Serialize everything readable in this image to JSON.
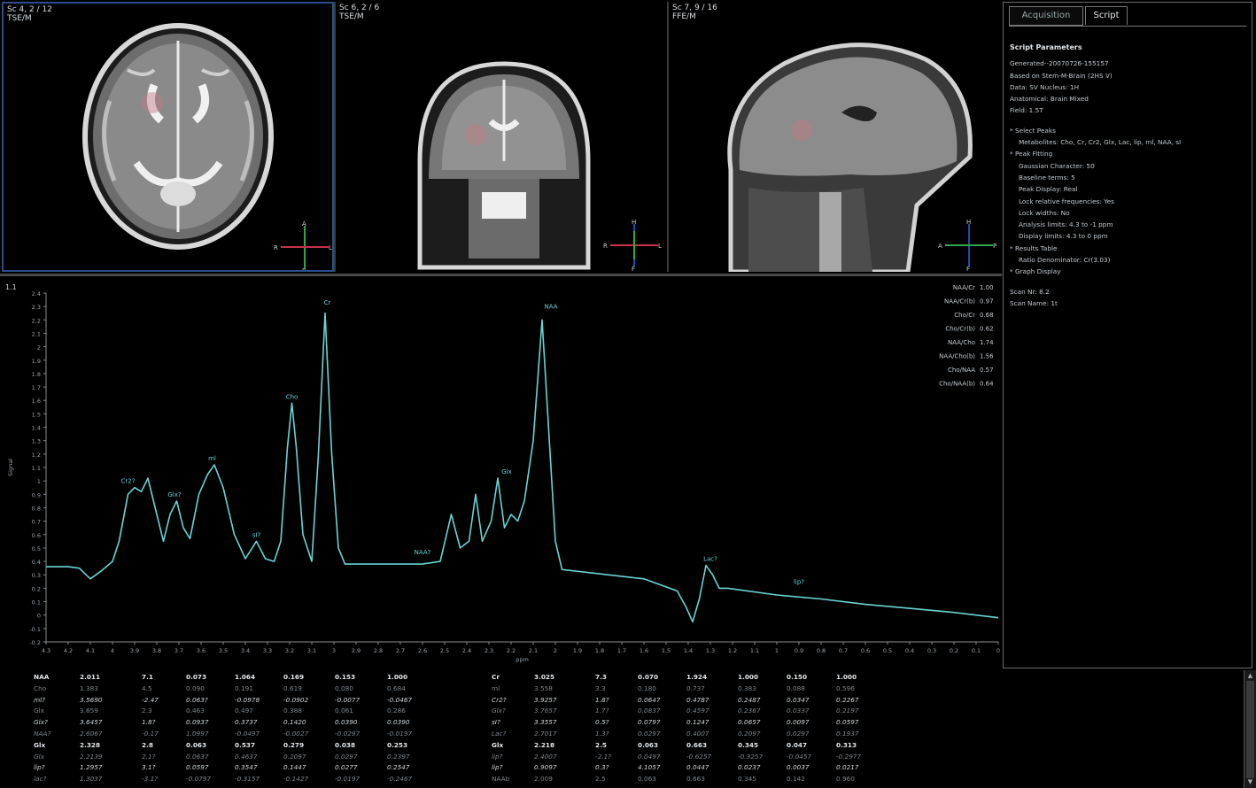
{
  "viewports": [
    {
      "label_line1": "Sc 4, 2 / 12",
      "label_line2": "TSE/M",
      "orientation": [
        "A",
        "R",
        "L",
        "P"
      ]
    },
    {
      "label_line1": "Sc 6, 2 / 6",
      "label_line2": "TSE/M",
      "orientation": [
        "H",
        "R",
        "L",
        "F"
      ]
    },
    {
      "label_line1": "Sc 7, 9 / 16",
      "label_line2": "FFE/M",
      "orientation": [
        "H",
        "A",
        "P",
        "F"
      ]
    }
  ],
  "tabs": {
    "acquisition": "Acquisition",
    "script": "Script"
  },
  "script_panel": {
    "title": "Script Parameters",
    "header_lines": [
      "Generated--20070726-155157",
      "Based on Stem-M-Brain (2HS V)",
      "Data: SV  Nucleus: 1H",
      "Anatomical: Brain  Mixed",
      "Field: 1.5T"
    ],
    "select_peaks_title": "* Select Peaks",
    "select_peaks": [
      "Metabolites: Cho, Cr, Cr2, Glx, Lac, lip, ml, NAA, sI"
    ],
    "peak_fitting_title": "* Peak Fitting",
    "peak_fitting": [
      "Gaussian Character: 50",
      "Baseline terms: 5",
      "Peak Display: Real",
      "Lock relative frequencies: Yes",
      "Lock widths: No",
      "Analysis limits: 4.3 to -1 ppm",
      "Display limits: 4.3 to 0 ppm"
    ],
    "results_table_title": "* Results Table",
    "results_table": [
      "Ratio Denominator: Cr(3.03)"
    ],
    "graph_display_title": "* Graph Display",
    "footer_lines": [
      "Scan Nr: 8.2",
      "Scan Name: 1t"
    ]
  },
  "chart_data": {
    "type": "line",
    "title": "",
    "corner_label": "1.1",
    "ylabel": "Signal",
    "xlabel": "ppm",
    "xlim": [
      4.3,
      0
    ],
    "ylim": [
      -0.2,
      2.4
    ],
    "x_ticks": [
      "4.3",
      "4.2",
      "4.1",
      "4",
      "3.9",
      "3.8",
      "3.7",
      "3.6",
      "3.5",
      "3.4",
      "3.3",
      "3.2",
      "3.1",
      "3",
      "2.9",
      "2.8",
      "2.7",
      "2.6",
      "2.5",
      "2.4",
      "2.3",
      "2.2",
      "2.1",
      "2",
      "1.9",
      "1.8",
      "1.7",
      "1.6",
      "1.5",
      "1.4",
      "1.3",
      "1.2",
      "1.1",
      "1",
      "0.9",
      "0.8",
      "0.7",
      "0.6",
      "0.5",
      "0.4",
      "0.3",
      "0.2",
      "0.1",
      "0"
    ],
    "y_ticks": [
      "-0.2",
      "-0.1",
      "0",
      "0.1",
      "0.2",
      "0.3",
      "0.4",
      "0.5",
      "0.6",
      "0.7",
      "0.8",
      "0.9",
      "1",
      "1.1",
      "1.2",
      "1.3",
      "1.4",
      "1.5",
      "1.6",
      "1.7",
      "1.8",
      "1.9",
      "2",
      "2.1",
      "2.2",
      "2.3",
      "2.4"
    ],
    "series": [
      {
        "color": "#6ad4d4",
        "points": [
          [
            4.3,
            0.36
          ],
          [
            4.2,
            0.36
          ],
          [
            4.15,
            0.35
          ],
          [
            4.1,
            0.27
          ],
          [
            4.05,
            0.33
          ],
          [
            4.0,
            0.4
          ],
          [
            3.97,
            0.55
          ],
          [
            3.93,
            0.9
          ],
          [
            3.9,
            0.95
          ],
          [
            3.87,
            0.92
          ],
          [
            3.84,
            1.02
          ],
          [
            3.8,
            0.75
          ],
          [
            3.77,
            0.55
          ],
          [
            3.74,
            0.75
          ],
          [
            3.71,
            0.85
          ],
          [
            3.68,
            0.65
          ],
          [
            3.65,
            0.57
          ],
          [
            3.61,
            0.9
          ],
          [
            3.57,
            1.05
          ],
          [
            3.54,
            1.12
          ],
          [
            3.5,
            0.95
          ],
          [
            3.45,
            0.6
          ],
          [
            3.4,
            0.42
          ],
          [
            3.35,
            0.55
          ],
          [
            3.31,
            0.42
          ],
          [
            3.27,
            0.4
          ],
          [
            3.24,
            0.55
          ],
          [
            3.21,
            1.25
          ],
          [
            3.19,
            1.58
          ],
          [
            3.17,
            1.25
          ],
          [
            3.14,
            0.6
          ],
          [
            3.1,
            0.4
          ],
          [
            3.07,
            1.2
          ],
          [
            3.04,
            2.25
          ],
          [
            3.01,
            1.2
          ],
          [
            2.98,
            0.5
          ],
          [
            2.95,
            0.38
          ],
          [
            2.8,
            0.38
          ],
          [
            2.6,
            0.38
          ],
          [
            2.52,
            0.4
          ],
          [
            2.47,
            0.75
          ],
          [
            2.43,
            0.5
          ],
          [
            2.39,
            0.55
          ],
          [
            2.36,
            0.9
          ],
          [
            2.33,
            0.55
          ],
          [
            2.29,
            0.7
          ],
          [
            2.26,
            1.02
          ],
          [
            2.23,
            0.65
          ],
          [
            2.2,
            0.75
          ],
          [
            2.17,
            0.7
          ],
          [
            2.14,
            0.85
          ],
          [
            2.1,
            1.3
          ],
          [
            2.06,
            2.2
          ],
          [
            2.02,
            1.1
          ],
          [
            2.0,
            0.55
          ],
          [
            1.97,
            0.34
          ],
          [
            1.6,
            0.27
          ],
          [
            1.45,
            0.18
          ],
          [
            1.41,
            0.06
          ],
          [
            1.38,
            -0.05
          ],
          [
            1.35,
            0.12
          ],
          [
            1.32,
            0.37
          ],
          [
            1.29,
            0.3
          ],
          [
            1.26,
            0.2
          ],
          [
            1.22,
            0.2
          ],
          [
            1.0,
            0.15
          ],
          [
            0.8,
            0.12
          ],
          [
            0.6,
            0.08
          ],
          [
            0.4,
            0.05
          ],
          [
            0.2,
            0.02
          ],
          [
            0.0,
            -0.02
          ]
        ]
      }
    ],
    "peak_labels": [
      {
        "x": 3.93,
        "y": 0.95,
        "text": "Cr2?"
      },
      {
        "x": 3.72,
        "y": 0.85,
        "text": "Glx?"
      },
      {
        "x": 3.55,
        "y": 1.12,
        "text": "ml"
      },
      {
        "x": 3.35,
        "y": 0.55,
        "text": "sI?"
      },
      {
        "x": 3.19,
        "y": 1.58,
        "text": "Cho"
      },
      {
        "x": 3.03,
        "y": 2.28,
        "text": "Cr"
      },
      {
        "x": 2.6,
        "y": 0.42,
        "text": "NAA?"
      },
      {
        "x": 2.22,
        "y": 1.02,
        "text": "Glx"
      },
      {
        "x": 2.02,
        "y": 2.25,
        "text": "NAA"
      },
      {
        "x": 1.3,
        "y": 0.37,
        "text": "Lac?"
      },
      {
        "x": 0.9,
        "y": 0.2,
        "text": "lip?"
      }
    ],
    "ratios": [
      {
        "label": "NAA/Cr",
        "value": "1.00"
      },
      {
        "label": "NAA/Cr(b)",
        "value": "0.97"
      },
      {
        "label": "Cho/Cr",
        "value": "0.68"
      },
      {
        "label": "Cho/Cr(b)",
        "value": "0.62"
      },
      {
        "label": "NAA/Cho",
        "value": "1.74"
      },
      {
        "label": "NAA/Cho(b)",
        "value": "1.56"
      },
      {
        "label": "Cho/NAA",
        "value": "0.57"
      },
      {
        "label": "Cho/NAA(b)",
        "value": "0.64"
      }
    ]
  },
  "results_table": {
    "left": [
      {
        "name": "NAA",
        "cells": [
          "2.011",
          "7.1",
          "0.073",
          "1.064",
          "0.169",
          "0.153",
          "1.000"
        ],
        "style": "bold"
      },
      {
        "name": "Cho",
        "cells": [
          "1.383",
          "4.5",
          "0.090",
          "0.191",
          "0.619",
          "0.080",
          "0.684"
        ],
        "style": "dim"
      },
      {
        "name": "ml?",
        "cells": [
          "3.5690",
          "-2.47",
          "0.063?",
          "-0.0978",
          "-0.0902",
          "-0.0077",
          "-0.0467"
        ],
        "style": "italic"
      },
      {
        "name": "Glx",
        "cells": [
          "3.659",
          "2.3",
          "0.463",
          "0.497",
          "0.388",
          "0.061",
          "0.286"
        ],
        "style": "dim"
      },
      {
        "name": "Glx?",
        "cells": [
          "3.6457",
          "1.8?",
          "0.0937",
          "0.3737",
          "0.1420",
          "0.0390",
          "0.0390"
        ],
        "style": "italic"
      },
      {
        "name": "NAA?",
        "cells": [
          "2.6067",
          "-0.17",
          "1.0997",
          "-0.0497",
          "-0.0027",
          "-0.0297",
          "-0.0197"
        ],
        "style": "dimitalic"
      },
      {
        "name": "Glx",
        "cells": [
          "2.328",
          "2.8",
          "0.063",
          "0.537",
          "0.279",
          "0.038",
          "0.253"
        ],
        "style": "bold"
      },
      {
        "name": "Glx",
        "cells": [
          "2.2139",
          "2.1?",
          "0.0637",
          "0.4637",
          "0.2097",
          "0.0297",
          "0.2397"
        ],
        "style": "dimitalic"
      },
      {
        "name": "lip?",
        "cells": [
          "1.2957",
          "3.1?",
          "0.0597",
          "0.3547",
          "0.1447",
          "0.0277",
          "0.2547"
        ],
        "style": "italic"
      },
      {
        "name": "lac?",
        "cells": [
          "1.3037",
          "-3.1?",
          "-0.0797",
          "-0.3157",
          "-0.1427",
          "-0.0197",
          "-0.2467"
        ],
        "style": "dimitalic"
      }
    ],
    "right": [
      {
        "name": "Cr",
        "cells": [
          "3.025",
          "7.3",
          "0.070",
          "1.924",
          "1.000",
          "0.150",
          "1.000"
        ],
        "style": "bold"
      },
      {
        "name": "ml",
        "cells": [
          "3.558",
          "3.3",
          "0.180",
          "0.737",
          "0.383",
          "0.088",
          "0.596"
        ],
        "style": "dim"
      },
      {
        "name": "Cr2?",
        "cells": [
          "3.9257",
          "1.8?",
          "0.0647",
          "0.4787",
          "0.2487",
          "0.0347",
          "0.2267"
        ],
        "style": "italic"
      },
      {
        "name": "Glx?",
        "cells": [
          "3.7657",
          "1.7?",
          "0.0837",
          "0.4597",
          "0.2367",
          "0.0337",
          "0.2197"
        ],
        "style": "dimitalic"
      },
      {
        "name": "sI?",
        "cells": [
          "3.3557",
          "0.5?",
          "0.0797",
          "0.1247",
          "0.0657",
          "0.0097",
          "0.0597"
        ],
        "style": "italic"
      },
      {
        "name": "Lac?",
        "cells": [
          "2.7017",
          "1.3?",
          "0.0297",
          "0.4007",
          "0.2097",
          "0.0297",
          "0.1937"
        ],
        "style": "dimitalic"
      },
      {
        "name": "Glx",
        "cells": [
          "2.218",
          "2.5",
          "0.063",
          "0.663",
          "0.345",
          "0.047",
          "0.313"
        ],
        "style": "bold"
      },
      {
        "name": "lip?",
        "cells": [
          "2.4007",
          "-2.1?",
          "0.0497",
          "-0.6257",
          "-0.3257",
          "-0.0457",
          "-0.2977"
        ],
        "style": "dimitalic"
      },
      {
        "name": "lip?",
        "cells": [
          "0.9097",
          "0.3?",
          "4.1057",
          "0.0447",
          "0.0237",
          "0.0037",
          "0.0217"
        ],
        "style": "italic"
      },
      {
        "name": "NAAb",
        "cells": [
          "2.009",
          "2.5",
          "0.063",
          "0.663",
          "0.345",
          "0.142",
          "0.960"
        ],
        "style": "dim"
      }
    ]
  }
}
